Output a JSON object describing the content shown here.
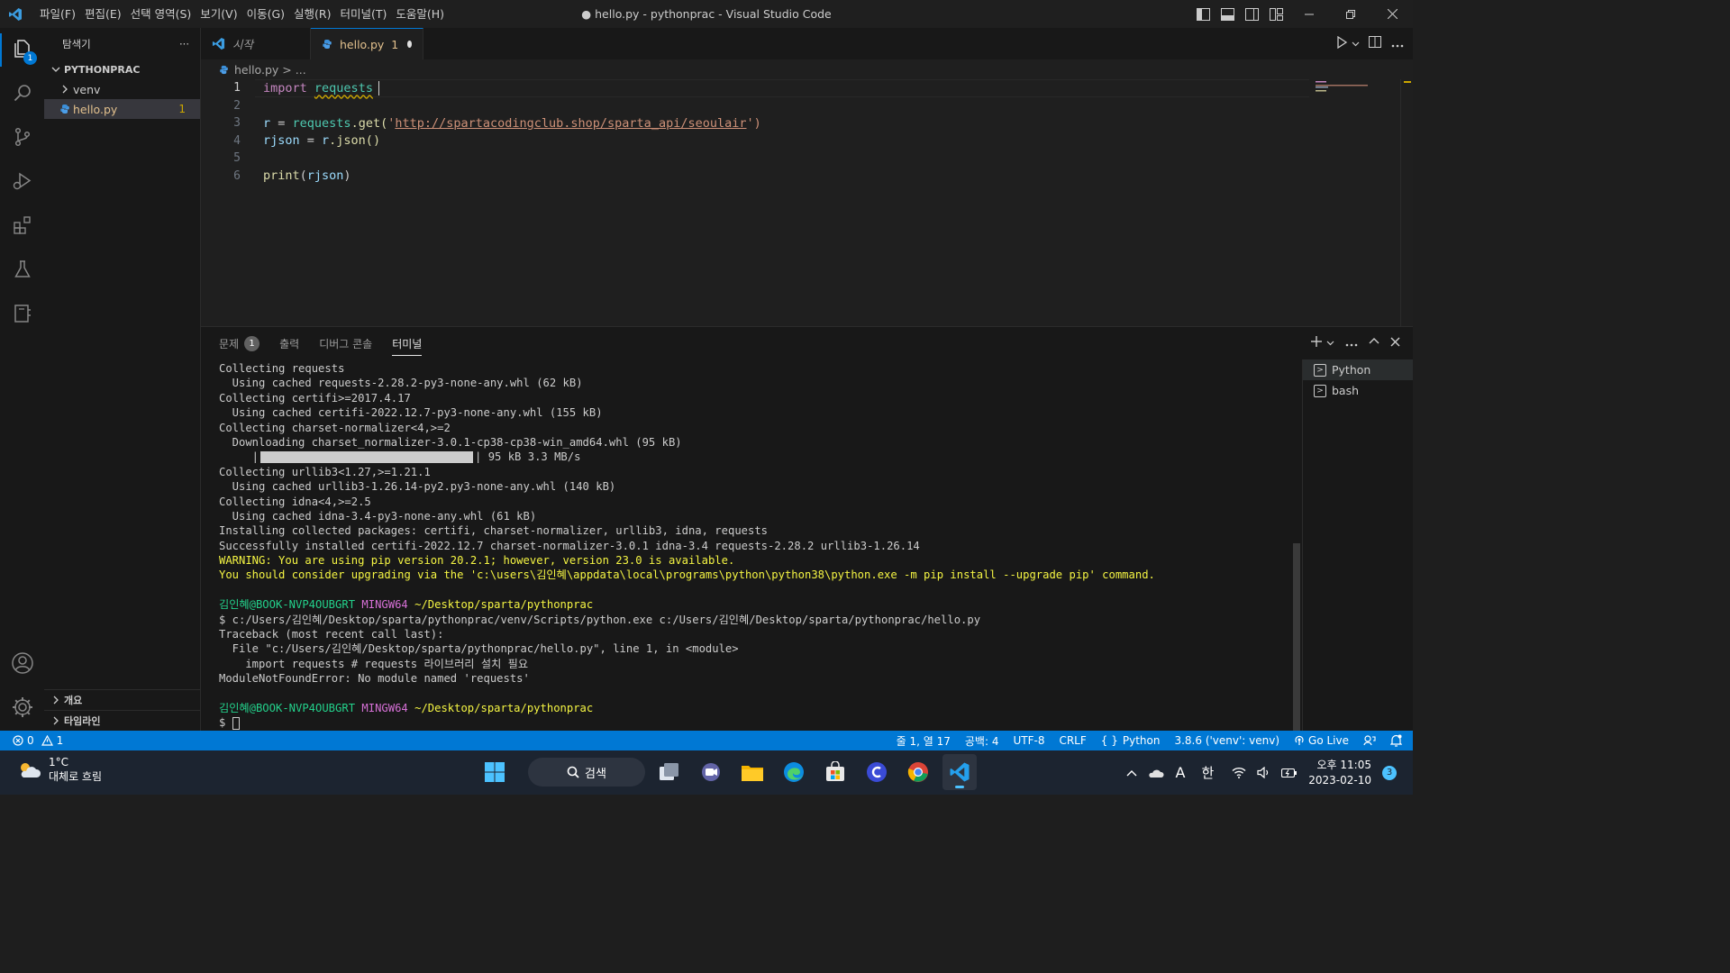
{
  "window": {
    "title": "● hello.py - pythonprac - Visual Studio Code",
    "menus": [
      "파일(F)",
      "편집(E)",
      "선택 영역(S)",
      "보기(V)",
      "이동(G)",
      "실행(R)",
      "터미널(T)",
      "도움말(H)"
    ]
  },
  "activity": {
    "explorer_badge": "1"
  },
  "sidebar": {
    "title": "탐색기",
    "more": "···",
    "root": "PYTHONPRAC",
    "items": [
      {
        "label": "venv"
      },
      {
        "label": "hello.py",
        "count": "1"
      }
    ],
    "outline": "개요",
    "timeline": "타임라인"
  },
  "tabs": [
    {
      "label": "시작"
    },
    {
      "label": "hello.py",
      "count": "1"
    }
  ],
  "breadcrumb": {
    "file": "hello.py",
    "rest": "> ..."
  },
  "editor": {
    "line_numbers": [
      "1",
      "2",
      "3",
      "4",
      "5",
      "6"
    ],
    "line1": {
      "kw": "import",
      "mod": "requests"
    },
    "line3": {
      "var": "r",
      "op": " = ",
      "mod": "requests",
      "fn": ".get(",
      "q1": "'",
      "url": "http://spartacodingclub.shop/sparta_api/seoulair",
      "q2": "')"
    },
    "line4": {
      "var": "rjson",
      "op": " = ",
      "obj": "r",
      "fn": ".json()"
    },
    "line6": {
      "fn": "print",
      "open": "(",
      "var": "rjson",
      "close": ")"
    }
  },
  "panel": {
    "tabs": [
      {
        "label": "문제",
        "count": "1"
      },
      {
        "label": "출력"
      },
      {
        "label": "디버그 콘솔"
      },
      {
        "label": "터미널"
      }
    ],
    "terminals": [
      "Python",
      "bash"
    ],
    "output": {
      "l1": "Collecting requests",
      "l2": "  Using cached requests-2.28.2-py3-none-any.whl (62 kB)",
      "l3": "Collecting certifi>=2017.4.17",
      "l4": "  Using cached certifi-2022.12.7-py3-none-any.whl (155 kB)",
      "l5": "Collecting charset-normalizer<4,>=2",
      "l6": "  Downloading charset_normalizer-3.0.1-cp38-cp38-win_amd64.whl (95 kB)",
      "l7a": "     |",
      "l7b": "| 95 kB 3.3 MB/s",
      "l8": "Collecting urllib3<1.27,>=1.21.1",
      "l9": "  Using cached urllib3-1.26.14-py2.py3-none-any.whl (140 kB)",
      "l10": "Collecting idna<4,>=2.5",
      "l11": "  Using cached idna-3.4-py3-none-any.whl (61 kB)",
      "l12": "Installing collected packages: certifi, charset-normalizer, urllib3, idna, requests",
      "l13": "Successfully installed certifi-2022.12.7 charset-normalizer-3.0.1 idna-3.4 requests-2.28.2 urllib3-1.26.14",
      "l14": "WARNING: You are using pip version 20.2.1; however, version 23.0 is available.",
      "l15": "You should consider upgrading via the 'c:\\users\\김인혜\\appdata\\local\\programs\\python\\python38\\python.exe -m pip install --upgrade pip' command.",
      "prompt_user": "김인혜@BOOK-NVP4OUBGRT",
      "prompt_shell": "MINGW64",
      "prompt_path": "~/Desktop/sparta/pythonprac",
      "l17": "$ c:/Users/김인혜/Desktop/sparta/pythonprac/venv/Scripts/python.exe c:/Users/김인혜/Desktop/sparta/pythonprac/hello.py",
      "l18": "Traceback (most recent call last):",
      "l19": "  File \"c:/Users/김인혜/Desktop/sparta/pythonprac/hello.py\", line 1, in <module>",
      "l20": "    import requests # requests 라이브러리 설치 필요",
      "l21": "ModuleNotFoundError: No module named 'requests'",
      "l23": "$ "
    },
    "progress_fraction": 1.0
  },
  "status": {
    "errors": "0",
    "warnings": "1",
    "position": "줄 1, 열 17",
    "spaces": "공백: 4",
    "encoding": "UTF-8",
    "eol": "CRLF",
    "language": "Python",
    "interpreter": "3.8.6 ('venv': venv)",
    "golive": "Go Live"
  },
  "taskbar": {
    "temp": "1°C",
    "weather": "대체로 흐림",
    "search": "검색",
    "ime": "한",
    "font_icon": "A",
    "time": "오후 11:05",
    "date": "2023-02-10",
    "notifications": "3"
  }
}
